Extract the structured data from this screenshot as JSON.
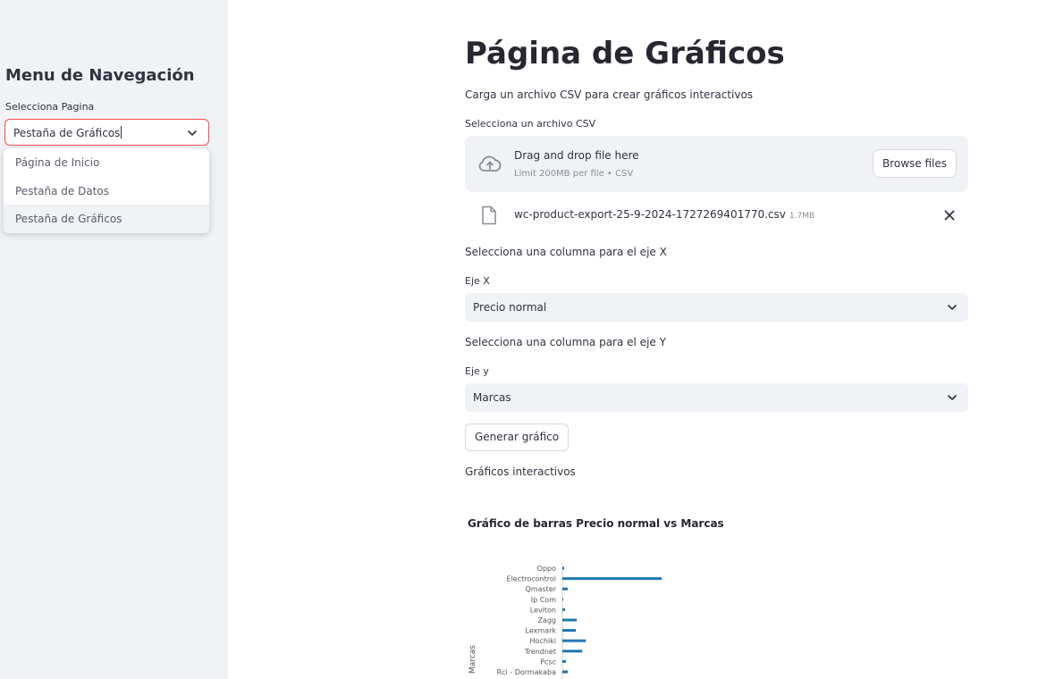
{
  "sidebar": {
    "title": "Menu de Navegación",
    "select_label": "Selecciona Pagina",
    "select_value": "Pestaña de Gráficos",
    "options": [
      "Página de Inicio",
      "Pestaña de Datos",
      "Pestaña de Gráficos"
    ],
    "selected_index": 2,
    "focus_color": "#ff4b4b"
  },
  "main": {
    "title": "Página de Gráficos",
    "subtitle": "Carga un archivo CSV para crear gráficos interactivos",
    "uploader": {
      "label": "Selecciona un archivo CSV",
      "drop_text": "Drag and drop file here",
      "limit_text": "Limit 200MB per file • CSV",
      "browse_label": "Browse files"
    },
    "file": {
      "name": "wc-product-export-25-9-2024-1727269401770.csv",
      "size": "1.7MB"
    },
    "x_prompt": "Selecciona una columna para el eje X",
    "x_label": "Eje X",
    "x_value": "Precio normal",
    "y_prompt": "Selecciona una columna para el eje Y",
    "y_label": "Eje y",
    "y_value": "Marcas",
    "generate_label": "Generar gráfico",
    "charts_heading": "Gráficos interactivos"
  },
  "chart_data": {
    "type": "bar",
    "orientation": "horizontal",
    "title": "Gráfico de barras Precio normal vs Marcas",
    "xlabel": "",
    "ylabel": "Marcas",
    "categories": [
      "Oppo",
      "Electrocontrol",
      "Qmaster",
      "Ip Com",
      "Leviton",
      "Zagg",
      "Lexmark",
      "Hochiki",
      "Trendnet",
      "Pcsc",
      "Rci - Dormakaba"
    ],
    "values": [
      2,
      110,
      6,
      1,
      3,
      16,
      15,
      26,
      22,
      4,
      6
    ],
    "bar_color": "#1f77b4"
  }
}
